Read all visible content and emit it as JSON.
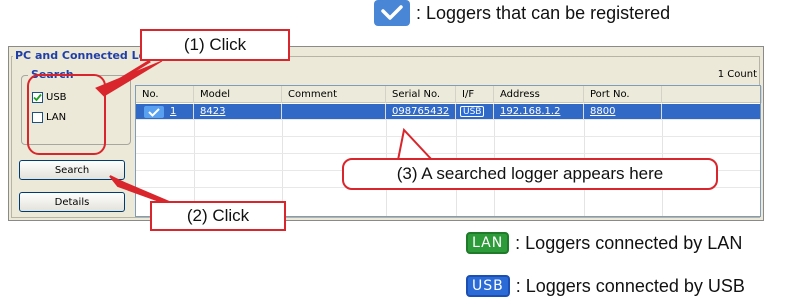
{
  "legend": {
    "registrable_text": ": Loggers that can be registered",
    "lan_badge": "LAN",
    "lan_text": ": Loggers connected by LAN",
    "usb_badge": "USB",
    "usb_text": ": Loggers connected by USB"
  },
  "window": {
    "title": "PC and Connected Lo",
    "count": "1 Count",
    "search_group_label": "Search",
    "checkboxes": [
      {
        "label": "USB",
        "checked": true
      },
      {
        "label": "LAN",
        "checked": false
      }
    ],
    "search_button": "Search",
    "details_button": "Details"
  },
  "table": {
    "columns": [
      "No.",
      "Model",
      "Comment",
      "Serial No.",
      "I/F",
      "Address",
      "Port No."
    ],
    "rows": [
      {
        "no": "1",
        "model": "8423",
        "comment": "",
        "serial": "098765432",
        "if": "USB",
        "address": "192.168.1.2",
        "port": "8800",
        "registrable": true
      }
    ]
  },
  "callouts": {
    "step1": "(1) Click",
    "step2": "(2) Click",
    "step3": "(3) A searched logger appears here"
  },
  "colors": {
    "accent_red": "#d9262c",
    "check_blue": "#4a86d6",
    "lan_green": "#2e9b3a",
    "usb_blue": "#2b6bd8",
    "selection_blue": "#3169c6"
  }
}
